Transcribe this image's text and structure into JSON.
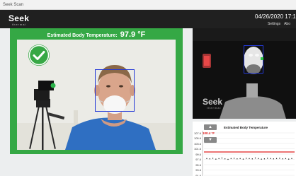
{
  "window": {
    "title": "Seek Scan"
  },
  "header": {
    "logo": "Seek",
    "logo_sub": "thermal",
    "datetime": "04/26/2020 17:1",
    "nav": [
      "Settings",
      "Abo"
    ]
  },
  "status": {
    "label": "Estimated Body Temperature:",
    "value": "97.9 °F",
    "state": "pass",
    "color": "#35a845"
  },
  "thermal_watermark": {
    "logo": "Seek",
    "sub": "thermal"
  },
  "graph": {
    "title": "Estimated Body Temperature",
    "latest": "100.4 °F",
    "up_label": "▲",
    "down_label": "▼"
  },
  "chart_data": {
    "type": "scatter",
    "title": "Estimated Body Temperature",
    "yticks": [
      "107.6",
      "105.6",
      "103.6",
      "101.6",
      "99.6",
      "97.6",
      "95.6",
      "93.6",
      "91.6"
    ],
    "ylim": [
      91.6,
      107.6
    ],
    "threshold": 100.4,
    "threshold_color": "#e02020",
    "values": [
      97.9,
      97.8,
      98.0,
      97.7,
      97.9,
      98.1,
      97.8,
      97.6,
      97.9,
      98.0,
      97.8,
      97.9,
      97.7,
      98.0,
      97.9,
      97.8,
      98.1,
      97.9,
      97.7,
      97.8,
      98.0,
      97.9,
      97.8,
      97.9,
      98.0,
      97.8,
      97.9,
      97.7,
      97.9
    ]
  }
}
